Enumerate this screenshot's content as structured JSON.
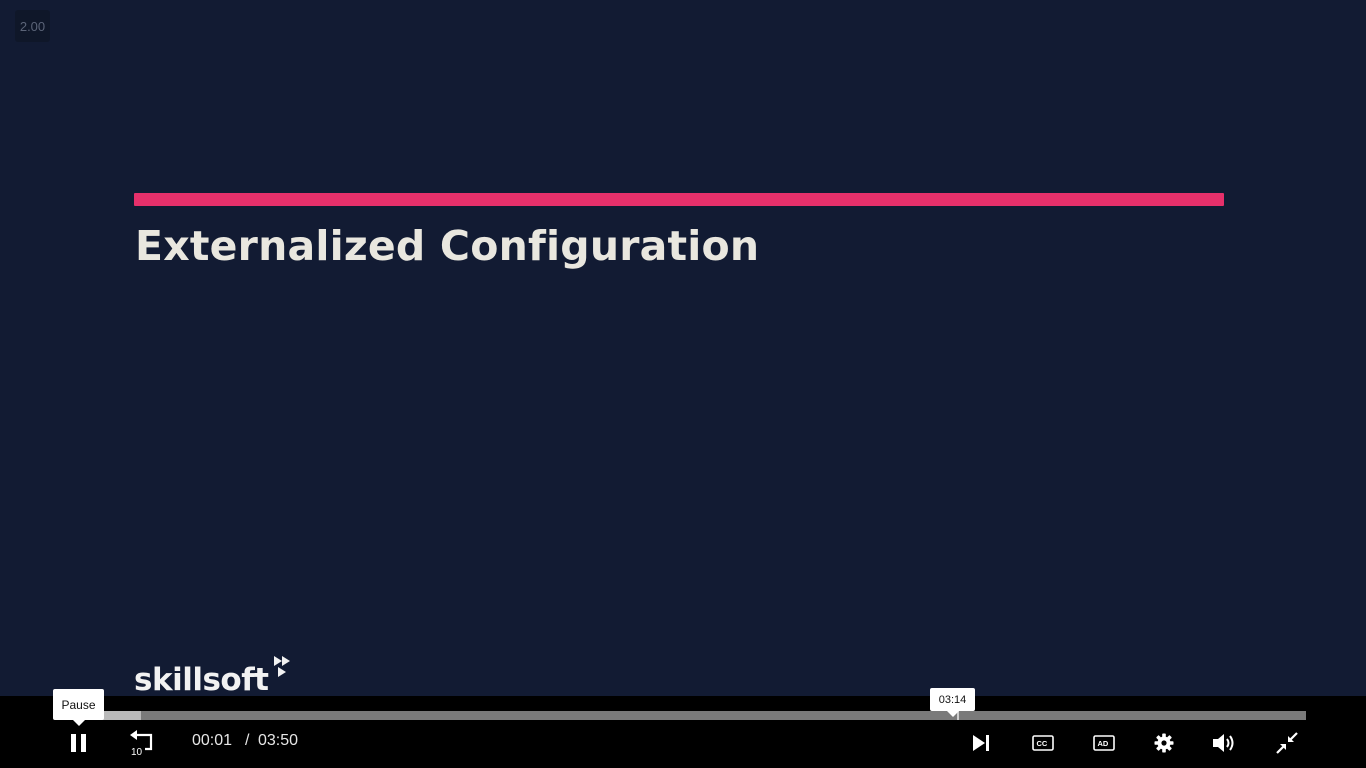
{
  "player": {
    "speed_badge": "2.00",
    "slide": {
      "title": "Externalized Configuration",
      "accent_color": "#e6306b"
    },
    "logo": {
      "text": "skillsoft",
      "mark": "skillsoft-chevrons"
    },
    "progress": {
      "played_fraction": 0.056,
      "hover_fraction": 0.717,
      "hover_tooltip": "03:14"
    },
    "controls": {
      "pause_tooltip": "Pause",
      "current_time": "00:01",
      "separator": "/",
      "total_time": "03:50",
      "rewind_label": "10",
      "icons": [
        "pause-icon",
        "rewind-10-icon",
        "skip-next-icon",
        "closed-captions-icon",
        "audio-description-icon",
        "settings-gear-icon",
        "volume-icon",
        "exit-fullscreen-icon"
      ]
    }
  }
}
